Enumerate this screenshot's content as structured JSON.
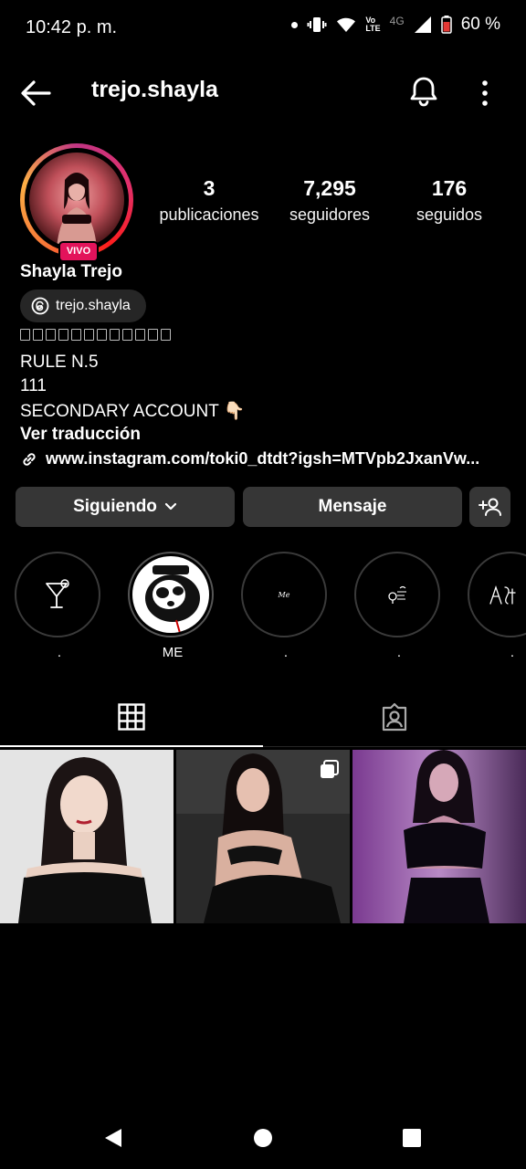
{
  "status_bar": {
    "time": "10:42 p. m.",
    "network_volte": "Vo",
    "network_lte": "LTE",
    "network_type": "4G",
    "battery": "60 %"
  },
  "header": {
    "username": "trejo.shayla"
  },
  "profile": {
    "live_badge": "VIVO",
    "stats": [
      {
        "value": "3",
        "label": "publicaciones"
      },
      {
        "value": "7,295",
        "label": "seguidores"
      },
      {
        "value": "176",
        "label": "seguidos"
      }
    ],
    "full_name": "Shayla Trejo",
    "threads_handle": "trejo.shayla",
    "bio_lines": [
      "RULE N.5",
      "111",
      "SECONDARY ACCOUNT 👇🏻"
    ],
    "translate": "Ver traducción",
    "link": "www.instagram.com/toki0_dtdt?igsh=MTVpb2JxanVw..."
  },
  "actions": {
    "following": "Siguiendo",
    "message": "Mensaje"
  },
  "highlights": [
    {
      "label": ".",
      "icon": "cocktail-icon"
    },
    {
      "label": "ME",
      "icon": "panda-cover"
    },
    {
      "label": ".",
      "icon": "me-script"
    },
    {
      "label": ".",
      "icon": "location-scribble"
    },
    {
      "label": ".",
      "icon": "sketch-figures"
    }
  ],
  "highlight_cover_texts": {
    "me_script": "Me"
  },
  "tabs": [
    {
      "name": "posts-grid",
      "icon": "grid-icon",
      "selected": true
    },
    {
      "name": "tagged",
      "icon": "tagged-person-icon",
      "selected": false
    }
  ],
  "colors": {
    "background": "#000000",
    "button": "#363636",
    "live": "#e3135b"
  }
}
